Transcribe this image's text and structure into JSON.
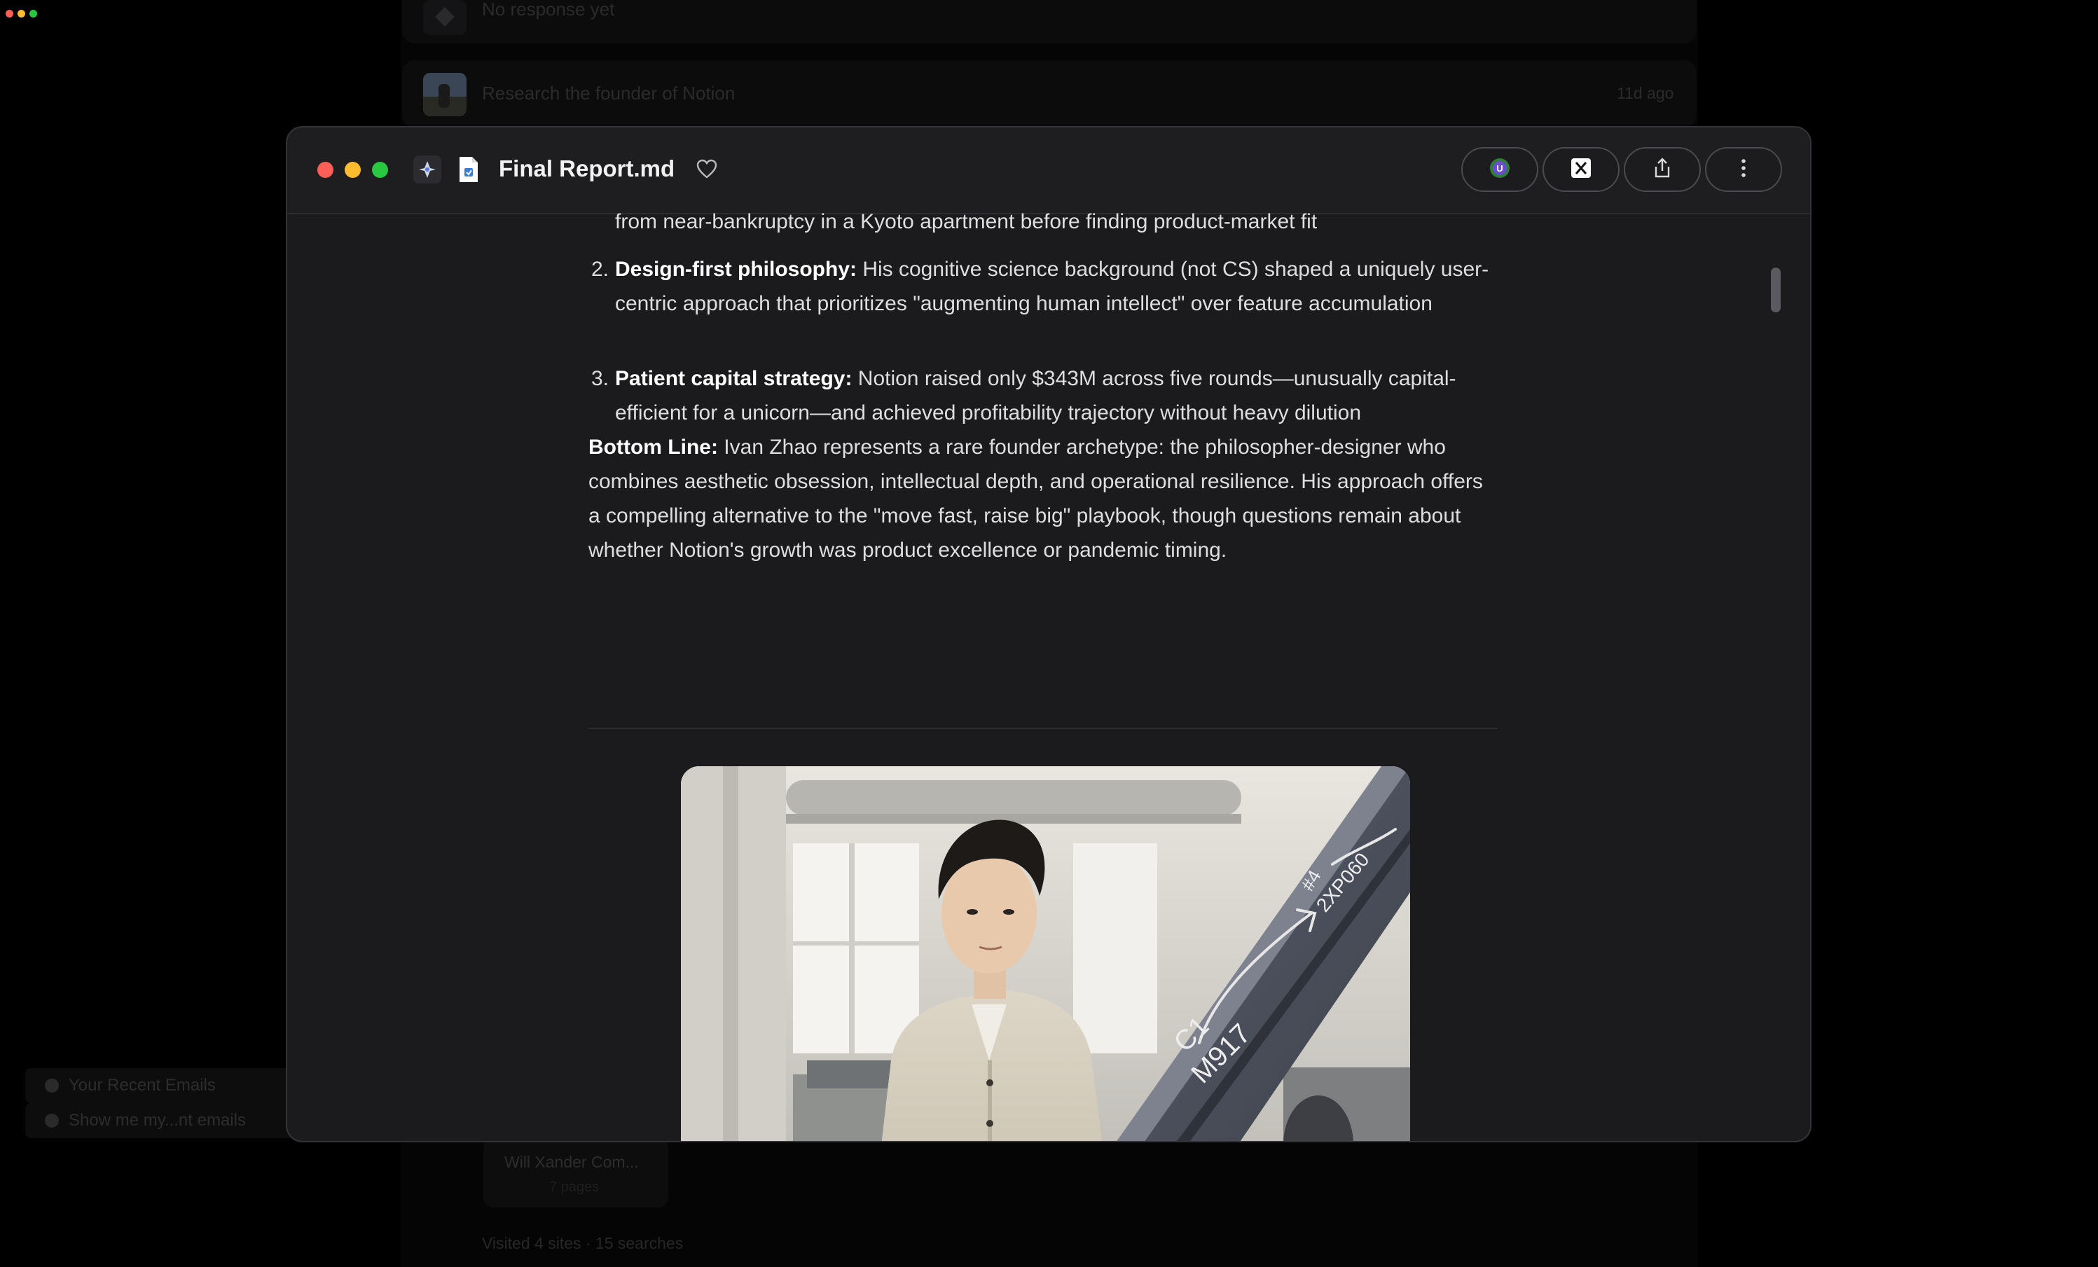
{
  "background": {
    "top_row_text": "No response yet",
    "task_title": "Research the founder of Notion",
    "task_time": "11d ago",
    "recent_items": [
      "Your Recent Emails",
      "Show me my...nt emails"
    ],
    "tile_title": "Will Xander Com...",
    "tile_subtitle": "7 pages",
    "visited": "Visited 4 sites · 15 searches"
  },
  "modal": {
    "title": "Final Report.md",
    "colors": {
      "close": "#ff5f57",
      "minimize": "#febc2e",
      "maximize": "#28c840"
    },
    "toolbar_icons": [
      "u-avatar-icon",
      "x-logo-icon",
      "share-icon",
      "more-icon"
    ]
  },
  "report": {
    "clipped_line": "from near-bankruptcy in a Kyoto apartment before finding product-market fit",
    "items": [
      {
        "number": "2.",
        "heading": "Design-first philosophy:",
        "text": " His cognitive science background (not CS) shaped a uniquely user-centric approach that prioritizes \"augmenting human intellect\" over feature accumulation"
      },
      {
        "number": "3.",
        "heading": "Patient capital strategy:",
        "text": " Notion raised only $343M across five rounds—unusually capital-efficient for a unicorn—and achieved profitability trajectory without heavy dilution"
      }
    ],
    "bottom_line": {
      "heading": "Bottom Line:",
      "text": " Ivan Zhao represents a rare founder archetype: the philosopher-designer who combines aesthetic obsession, intellectual depth, and operational resilience. His approach offers a compelling alternative to the \"move fast, raise big\" playbook, though questions remain about whether Notion's growth was product excellence or pandemic timing."
    },
    "photo_beam_text": [
      "C1",
      "M917",
      "#4",
      "2XP060"
    ]
  }
}
